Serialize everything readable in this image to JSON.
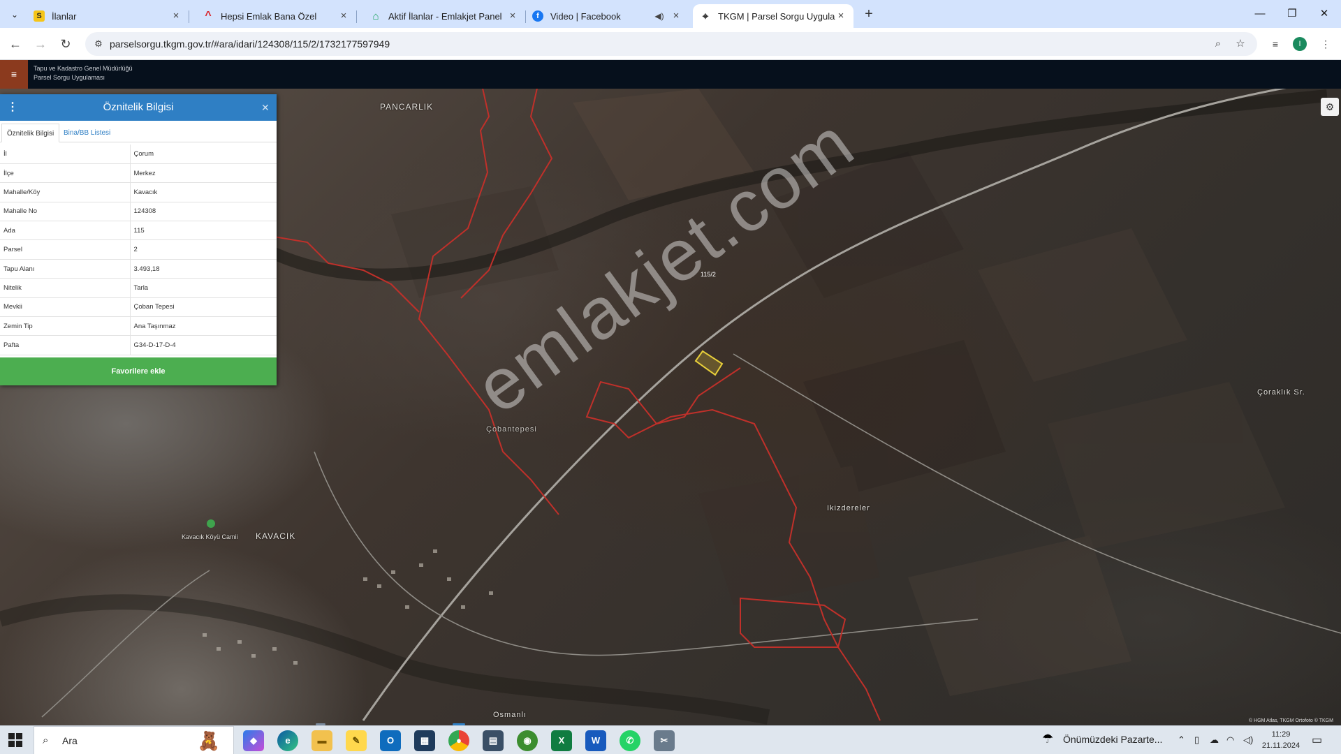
{
  "browser": {
    "tabs": [
      {
        "title": "İlanlar",
        "favicon": "S"
      },
      {
        "title": "Hepsi Emlak Bana Özel",
        "favicon": "^"
      },
      {
        "title": "Aktif İlanlar - Emlakjet Panel",
        "favicon": "⌂"
      },
      {
        "title": "Video | Facebook",
        "favicon": "f"
      },
      {
        "title": "TKGM | Parsel Sorgu Uygulaması",
        "favicon": "⌖"
      }
    ],
    "url": "parselsorgu.tkgm.gov.tr/#ara/idari/124308/115/2/1732177597949",
    "profile_initial": "I"
  },
  "app": {
    "org_line1": "Tapu ve Kadastro Genel Müdürlüğü",
    "org_line2": "Parsel Sorgu Uygulaması"
  },
  "panel": {
    "title": "Öznitelik Bilgisi",
    "tabs": [
      "Öznitelik Bilgisi",
      "Bina/BB Listesi"
    ],
    "rows": [
      {
        "key": "İl",
        "value": "Çorum"
      },
      {
        "key": "İlçe",
        "value": "Merkez"
      },
      {
        "key": "Mahalle/Köy",
        "value": "Kavacık"
      },
      {
        "key": "Mahalle No",
        "value": "124308"
      },
      {
        "key": "Ada",
        "value": "115"
      },
      {
        "key": "Parsel",
        "value": "2"
      },
      {
        "key": "Tapu Alanı",
        "value": "3.493,18"
      },
      {
        "key": "Nitelik",
        "value": "Tarla"
      },
      {
        "key": "Mevkii",
        "value": "Çoban Tepesi"
      },
      {
        "key": "Zemin Tip",
        "value": "Ana Taşınmaz"
      },
      {
        "key": "Pafta",
        "value": "G34-D-17-D-4"
      }
    ],
    "favorite_button": "Favorilere ekle"
  },
  "map": {
    "labels": [
      "PANCARLIK",
      "Çobantepesi",
      "Ikizdereler",
      "Çoraklık Sr.",
      "KAVACIK",
      "Kavacık Köyü Camii",
      "Osmanlı"
    ],
    "parcel_label": "115/2",
    "watermark": "emlakjet.com",
    "attribution": "© HGM Atlas, TKGM Ortofoto © TKGM",
    "parcel_border_color": "#c0302a",
    "road_color": "#a6a39d"
  },
  "taskbar": {
    "search_placeholder": "Ara",
    "weather": "Önümüzdeki Pazarte...",
    "time": "11:29",
    "date": "21.11.2024"
  }
}
